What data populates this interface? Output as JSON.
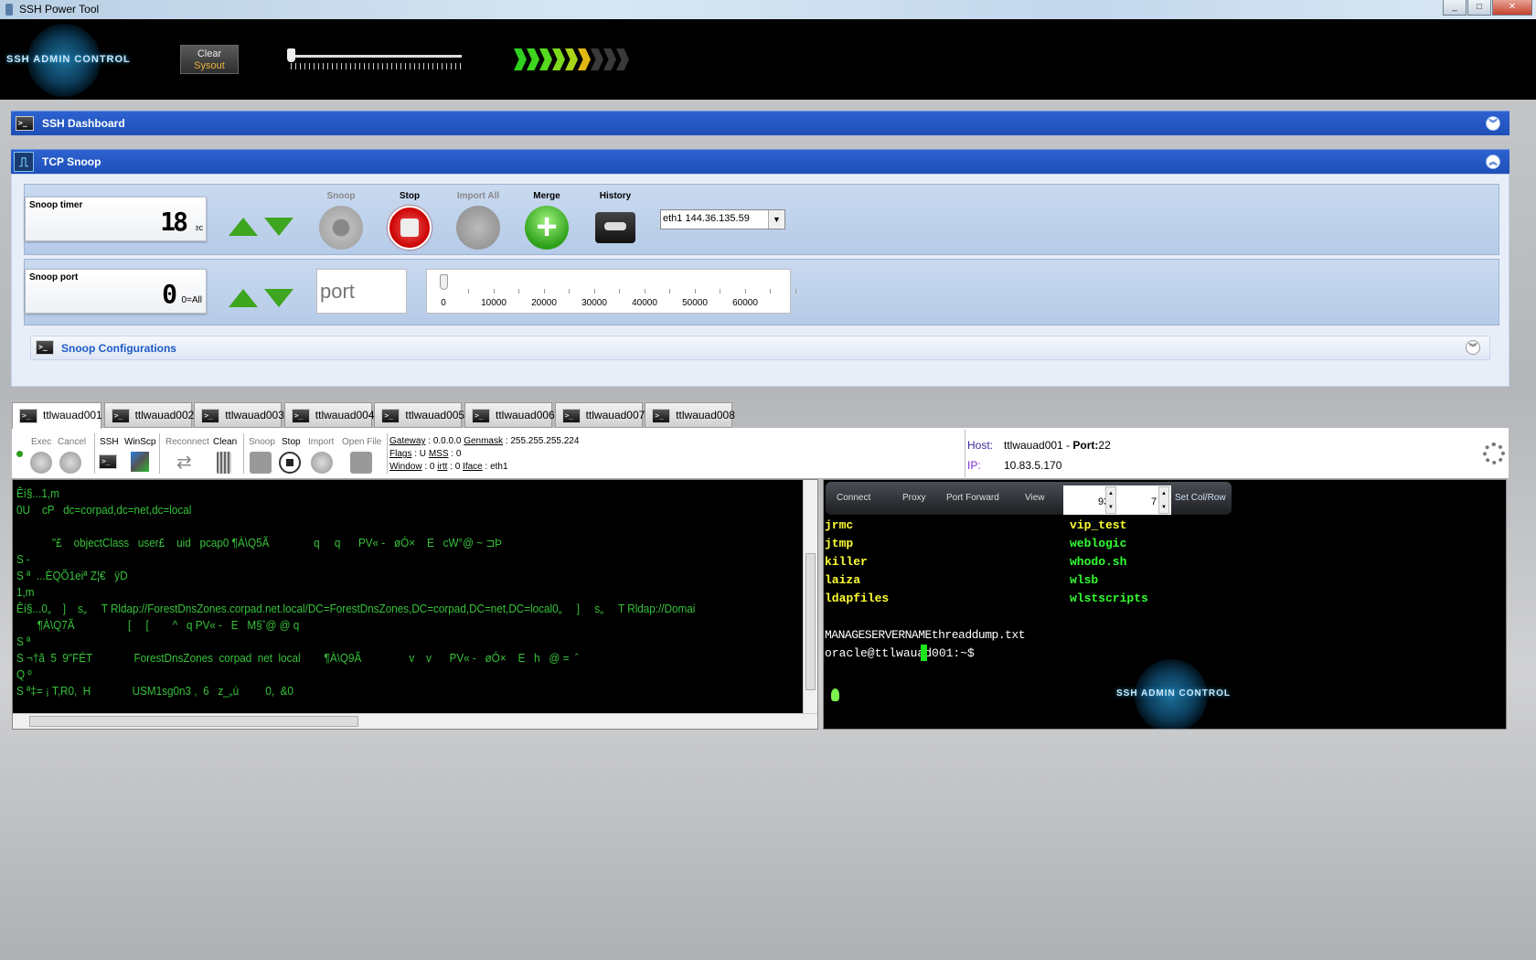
{
  "window": {
    "title": "SSH Power Tool",
    "controls": [
      "_",
      "□",
      "✕"
    ]
  },
  "header": {
    "logo_text": "SSH ADMIN CONTROL",
    "clear_label": "Clear",
    "sysout_label": "Sysout",
    "signal_level": 6,
    "signal_total": 9,
    "signal_colors": [
      "#2fd11e",
      "#3ed61e",
      "#57da1d",
      "#7fd91b",
      "#a9d417",
      "#e1b812"
    ]
  },
  "dashboard": {
    "title": "SSH Dashboard"
  },
  "tcp_snoop": {
    "title": "TCP Snoop",
    "timer": {
      "label": "Snoop timer",
      "value": "18",
      "unit": "sec"
    },
    "buttons": {
      "snoop": "Snoop",
      "stop": "Stop",
      "import_all": "Import All",
      "merge": "Merge",
      "history": "History"
    },
    "interface": "eth1 144.36.135.59",
    "port": {
      "label": "Snoop port",
      "value": "0",
      "unit": "0=All",
      "placeholder": "port"
    },
    "port_slider": {
      "ticks": [
        "0",
        "10000",
        "20000",
        "30000",
        "40000",
        "50000",
        "60000"
      ],
      "value": 0
    },
    "config_title": "Snoop Configurations"
  },
  "tabs": [
    "ttlwauad001",
    "ttlwauad002",
    "ttlwauad003",
    "ttlwauad004",
    "ttlwauad005",
    "ttlwauad006",
    "ttlwauad007",
    "ttlwauad008"
  ],
  "toolbar": {
    "exec": "Exec",
    "cancel": "Cancel",
    "ssh": "SSH",
    "winscp": "WinScp",
    "reconnect": "Reconnect",
    "clean": "Clean",
    "snoop": "Snoop",
    "stop": "Stop",
    "import": "Import",
    "open_file": "Open File",
    "gateway_label": "Gateway",
    "gateway": "0.0.0.0",
    "genmask_label": "Genmask",
    "genmask": "255.255.255.224",
    "flags_label": "Flags",
    "flags": "U",
    "mss_label": "MSS",
    "mss": "0",
    "window_label": "Window",
    "window": "0",
    "irtt_label": "irtt",
    "irtt": "0",
    "iface_label": "Iface",
    "iface": "eth1"
  },
  "host": {
    "host_label": "Host:",
    "host": "ttlwauad001",
    "port_label": "Port:",
    "port": "22",
    "ip_label": "IP:",
    "ip": "10.83.5.170"
  },
  "snoop_output": [
    "Êí§...1,m",
    "0U    cP   dc=corpad,dc=net,dc=local",
    "",
    "            \"£    objectClass   user£    uid   pcap0 ¶À\\Q5Ã               q     q      PV« -   øÓ×    E   cW°@ ~ ⊐Þ",
    "S -",
    "S ª  ...ÈQÕ1eiª Z¦€   ÿD",
    "1,m",
    "Êí§...0„    ]    s„     T Rldap://ForestDnsZones.corpad.net.local/DC=ForestDnsZones,DC=corpad,DC=net,DC=local0„     ]     s„     T Rldap://Domai",
    "       ¶À\\Q7Ã                  [     [        ^   q PV« -   E   M§ˆ@ @ q",
    "S ª",
    "S ¬†ã  5  9\"FÉT              ForestDnsZones  corpad  net  local        ¶À\\Q9Ã                v    v      PV« -   øÓ×    E   h   @ =  ˆ",
    "Q º",
    "S ª‡= ¡ T,R0,  H              USM1sg0n3 ,  6   z_„ú         0,  &0"
  ],
  "terminal": {
    "toolbar": {
      "connect": "Connect",
      "proxy": "Proxy",
      "port_forward": "Port Forward",
      "view": "View",
      "cols": "93",
      "rows": "7",
      "set": "Set Col/Row"
    },
    "listing_col1": [
      {
        "name": "jrmc",
        "color": "#ffff33"
      },
      {
        "name": "jtmp",
        "color": "#ffff33"
      },
      {
        "name": "killer",
        "color": "#ffff33"
      },
      {
        "name": "laiza",
        "color": "#ffff33"
      },
      {
        "name": "ldapfiles",
        "color": "#ffff33"
      }
    ],
    "listing_col2": [
      {
        "name": "vip_test",
        "color": "#ffff33"
      },
      {
        "name": "weblogic",
        "color": "#33ff33"
      },
      {
        "name": "whodo.sh",
        "color": "#33ff33"
      },
      {
        "name": "wlsb",
        "color": "#33ff33"
      },
      {
        "name": "wlstscripts",
        "color": "#33ff33"
      }
    ],
    "file_line": "MANAGESERVERNAMEthreaddump.txt",
    "prompt": "oracle@ttlwauad001:~$ ",
    "logo_text": "SSH ADMIN CONTROL"
  }
}
